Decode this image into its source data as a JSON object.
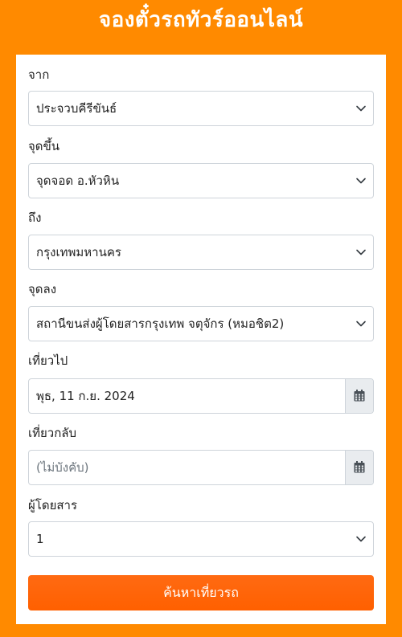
{
  "header": {
    "title": "จองตั๋วรถทัวร์ออนไลน์"
  },
  "form": {
    "origin": {
      "label": "จาก",
      "value": "ประจวบคีรีขันธ์"
    },
    "boarding_point": {
      "label": "จุดขึ้น",
      "value": "จุดจอด อ.หัวหิน"
    },
    "destination": {
      "label": "ถึง",
      "value": "กรุงเทพมหานคร"
    },
    "dropoff_point": {
      "label": "จุดลง",
      "value": "สถานีขนส่งผู้โดยสารกรุงเทพ จตุจักร (หมอชิต2)"
    },
    "depart_date": {
      "label": "เที่ยวไป",
      "value": "พุธ, 11 ก.ย. 2024"
    },
    "return_date": {
      "label": "เที่ยวกลับ",
      "placeholder": "(ไม่บังคับ)"
    },
    "passengers": {
      "label": "ผู้โดยสาร",
      "value": "1"
    },
    "search_label": "ค้นหาเที่ยวรถ"
  },
  "icons": {
    "select_arrow": "chevron-down-icon",
    "date_picker": "calendar-icon"
  },
  "colors": {
    "background": "#ff8a00",
    "button": "#ff6600",
    "card": "#ffffff",
    "addon": "#e9ecef"
  }
}
